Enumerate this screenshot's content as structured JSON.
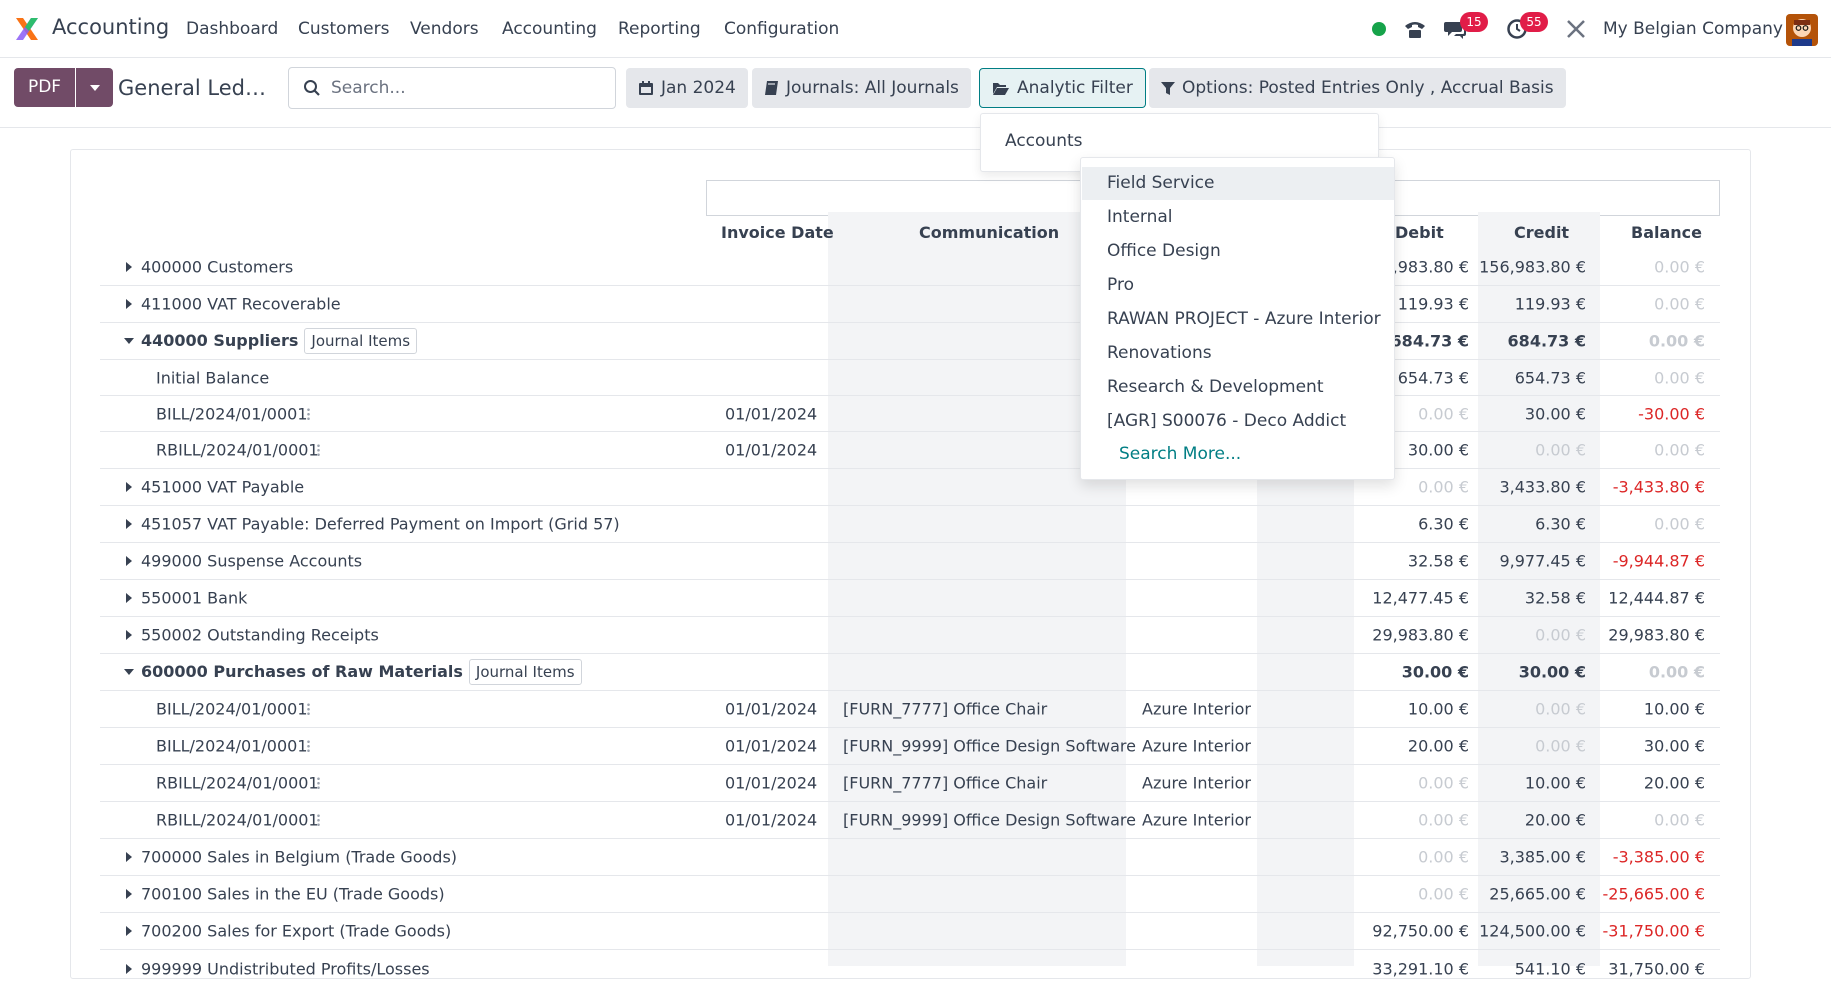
{
  "navbar": {
    "app_name": "Accounting",
    "menu": [
      "Dashboard",
      "Customers",
      "Vendors",
      "Accounting",
      "Reporting",
      "Configuration"
    ],
    "messages_badge": "15",
    "activities_badge": "55",
    "company": "My Belgian Company"
  },
  "control": {
    "pdf_label": "PDF",
    "report_title": "General Led…",
    "search_placeholder": "Search...",
    "date_filter": "Jan 2024",
    "journals_filter": "Journals: All Journals",
    "analytic_filter": "Analytic Filter",
    "options_filter": "Options: Posted Entries Only , Accrual Basis"
  },
  "analytic_dropdown": {
    "accounts_label": "Accounts",
    "options": [
      "Field Service",
      "Internal",
      "Office Design",
      "Pro",
      "RAWAN PROJECT - Azure Interior",
      "Renovations",
      "Research & Development",
      "[AGR] S00076 - Deco Addict"
    ],
    "search_more": "Search More..."
  },
  "table": {
    "headers": {
      "invoice_date": "Invoice Date",
      "communication": "Communication",
      "debit": "Debit",
      "credit": "Credit",
      "balance": "Balance"
    },
    "badge_label": "Journal Items",
    "rows": [
      {
        "label": "400000 Customers",
        "date": "",
        "comm": "",
        "partner": "",
        "debit": ",983.80 €",
        "credit": "156,983.80 €",
        "balance": "0.00 €"
      },
      {
        "label": "411000 VAT Recoverable",
        "date": "",
        "comm": "",
        "partner": "",
        "debit": "119.93 €",
        "credit": "119.93 €",
        "balance": "0.00 €"
      },
      {
        "label": "440000 Suppliers",
        "date": "",
        "comm": "",
        "partner": "",
        "debit": "684.73 €",
        "credit": "684.73 €",
        "balance": "0.00 €"
      },
      {
        "label": "Initial Balance",
        "date": "",
        "comm": "",
        "partner": "",
        "debit": "654.73 €",
        "credit": "654.73 €",
        "balance": "0.00 €"
      },
      {
        "label": "BILL/2024/01/0001",
        "date": "01/01/2024",
        "comm": "",
        "partner": "",
        "debit": "0.00 €",
        "credit": "30.00 €",
        "balance": "-30.00 €"
      },
      {
        "label": "RBILL/2024/01/0001",
        "date": "01/01/2024",
        "comm": "",
        "partner": "",
        "debit": "30.00 €",
        "credit": "0.00 €",
        "balance": "0.00 €"
      },
      {
        "label": "451000 VAT Payable",
        "date": "",
        "comm": "",
        "partner": "",
        "debit": "0.00 €",
        "credit": "3,433.80 €",
        "balance": "-3,433.80 €"
      },
      {
        "label": "451057 VAT Payable: Deferred Payment on Import (Grid 57)",
        "date": "",
        "comm": "",
        "partner": "",
        "debit": "6.30 €",
        "credit": "6.30 €",
        "balance": "0.00 €"
      },
      {
        "label": "499000 Suspense Accounts",
        "date": "",
        "comm": "",
        "partner": "",
        "debit": "32.58 €",
        "credit": "9,977.45 €",
        "balance": "-9,944.87 €"
      },
      {
        "label": "550001 Bank",
        "date": "",
        "comm": "",
        "partner": "",
        "debit": "12,477.45 €",
        "credit": "32.58 €",
        "balance": "12,444.87 €"
      },
      {
        "label": "550002 Outstanding Receipts",
        "date": "",
        "comm": "",
        "partner": "",
        "debit": "29,983.80 €",
        "credit": "0.00 €",
        "balance": "29,983.80 €"
      },
      {
        "label": "600000 Purchases of Raw Materials",
        "date": "",
        "comm": "",
        "partner": "",
        "debit": "30.00 €",
        "credit": "30.00 €",
        "balance": "0.00 €"
      },
      {
        "label": "BILL/2024/01/0001",
        "date": "01/01/2024",
        "comm": "[FURN_7777] Office Chair",
        "partner": "Azure Interior",
        "debit": "10.00 €",
        "credit": "0.00 €",
        "balance": "10.00 €"
      },
      {
        "label": "BILL/2024/01/0001",
        "date": "01/01/2024",
        "comm": "[FURN_9999] Office Design Software",
        "partner": "Azure Interior",
        "debit": "20.00 €",
        "credit": "0.00 €",
        "balance": "30.00 €"
      },
      {
        "label": "RBILL/2024/01/0001",
        "date": "01/01/2024",
        "comm": "[FURN_7777] Office Chair",
        "partner": "Azure Interior",
        "debit": "0.00 €",
        "credit": "10.00 €",
        "balance": "20.00 €"
      },
      {
        "label": "RBILL/2024/01/0001",
        "date": "01/01/2024",
        "comm": "[FURN_9999] Office Design Software",
        "partner": "Azure Interior",
        "debit": "0.00 €",
        "credit": "20.00 €",
        "balance": "0.00 €"
      },
      {
        "label": "700000 Sales in Belgium (Trade Goods)",
        "date": "",
        "comm": "",
        "partner": "",
        "debit": "0.00 €",
        "credit": "3,385.00 €",
        "balance": "-3,385.00 €"
      },
      {
        "label": "700100 Sales in the EU (Trade Goods)",
        "date": "",
        "comm": "",
        "partner": "",
        "debit": "0.00 €",
        "credit": "25,665.00 €",
        "balance": "-25,665.00 €"
      },
      {
        "label": "700200 Sales for Export (Trade Goods)",
        "date": "",
        "comm": "",
        "partner": "",
        "debit": "92,750.00 €",
        "credit": "124,500.00 €",
        "balance": "-31,750.00 €"
      },
      {
        "label": "999999 Undistributed Profits/Losses",
        "date": "",
        "comm": "",
        "partner": "",
        "debit": "33,291.10 €",
        "credit": "541.10 €",
        "balance": "31,750.00 €"
      }
    ]
  }
}
